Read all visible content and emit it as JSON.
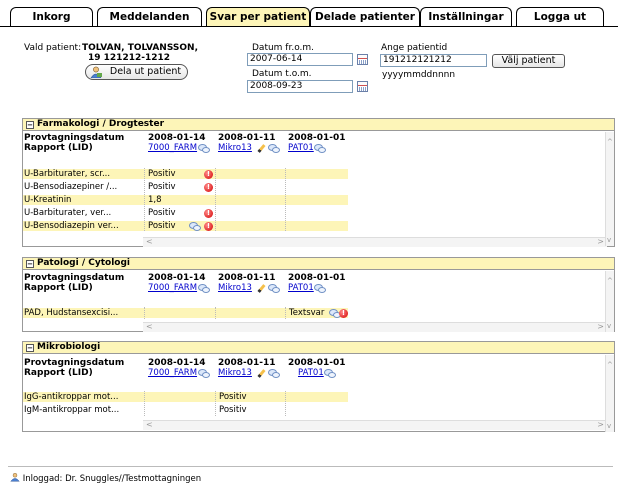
{
  "tabs": [
    {
      "label": "Inkorg",
      "active": false
    },
    {
      "label": "Meddelanden",
      "active": false
    },
    {
      "label": "Svar per patient",
      "active": true
    },
    {
      "label": "Delade patienter",
      "active": false
    },
    {
      "label": "Inställningar",
      "active": false
    },
    {
      "label": "Logga ut",
      "active": false
    }
  ],
  "patient": {
    "label": "Vald patient:",
    "name": "TOLVAN, TOLVANSSON,",
    "id": "19 121212-1212",
    "share_button": "Dela ut patient"
  },
  "dates": {
    "from_label": "Datum fr.o.m.",
    "from_value": "2007-06-14",
    "to_label": "Datum t.o.m.",
    "to_value": "2008-09-23"
  },
  "patient_id_input": {
    "label": "Ange patientid",
    "value": "191212121212",
    "hint": "yyyymmddnnnn",
    "button": "Välj patient"
  },
  "columns": [
    {
      "date": "2008-01-14",
      "link": "7000_FARM"
    },
    {
      "date": "2008-01-11",
      "link": "Mikro13"
    },
    {
      "date": "2008-01-01",
      "link": "PAT01"
    }
  ],
  "sections": [
    {
      "title": "Farmakologi / Drogtester",
      "header_line1": "Provtagningsdatum",
      "header_line2": "Rapport (LID)",
      "rows": [
        {
          "name": "U-Barbiturater, scr...",
          "values": [
            "Positiv",
            "",
            ""
          ],
          "flags": [
            "warn"
          ],
          "highlight": true
        },
        {
          "name": "U-Bensodiazepiner /...",
          "values": [
            "Positiv",
            "",
            ""
          ],
          "flags": [
            "warn"
          ],
          "highlight": false
        },
        {
          "name": "U-Kreatinin",
          "values": [
            "1,8",
            "",
            ""
          ],
          "flags": [],
          "highlight": true
        },
        {
          "name": "U-Barbiturater, ver...",
          "values": [
            "Positiv",
            "",
            ""
          ],
          "flags": [
            "warn"
          ],
          "highlight": false
        },
        {
          "name": "U-Bensodiazepin ver...",
          "values": [
            "Positiv",
            "",
            ""
          ],
          "flags": [
            "comment",
            "warn"
          ],
          "highlight": true
        }
      ]
    },
    {
      "title": "Patologi / Cytologi",
      "header_line1": "Provtagningsdatum",
      "header_line2": "Rapport (LID)",
      "rows": [
        {
          "name": "PAD, Hudstansexcisi...",
          "values": [
            "",
            "",
            "Textsvar"
          ],
          "flags": [
            "comment",
            "warn"
          ],
          "highlight": true
        }
      ]
    },
    {
      "title": "Mikrobiologi",
      "header_line1": "Provtagningsdatum",
      "header_line2": "Rapport (LID)",
      "rows": [
        {
          "name": "IgG-antikroppar mot...",
          "values": [
            "",
            "Positiv",
            ""
          ],
          "flags": [],
          "highlight": true
        },
        {
          "name": "IgM-antikroppar mot...",
          "values": [
            "",
            "Positiv",
            ""
          ],
          "flags": [],
          "highlight": false
        }
      ]
    }
  ],
  "footer": {
    "text": "Inloggad: Dr. Snuggles//Testmottagningen"
  },
  "colors": {
    "highlight": "#fdf5b8",
    "link": "#0000cc",
    "warn": "#d40000"
  }
}
